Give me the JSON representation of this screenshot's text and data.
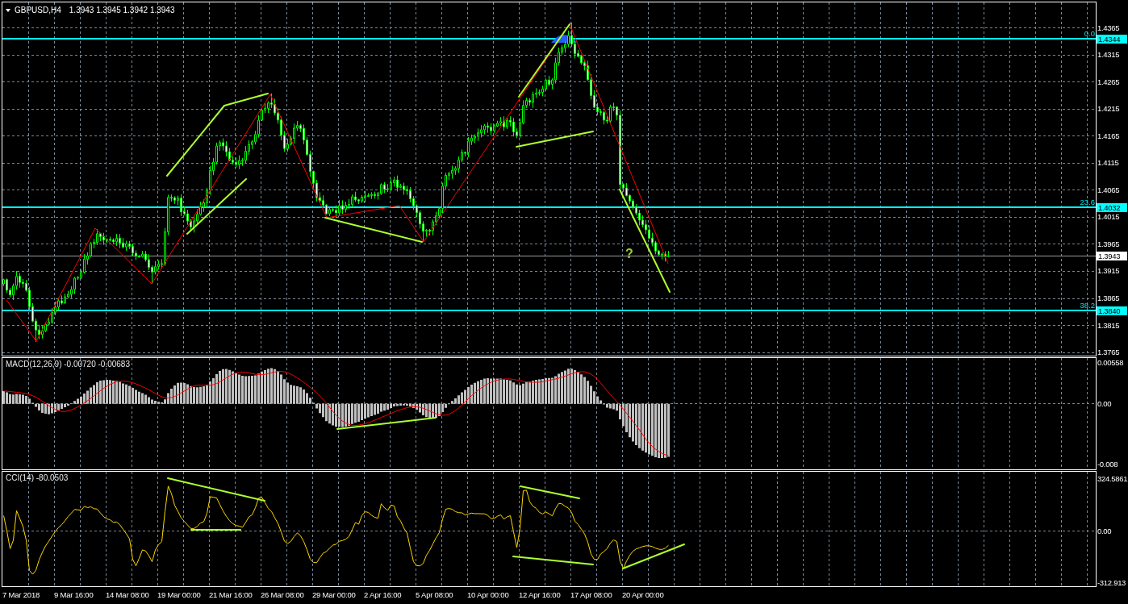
{
  "chart": {
    "symbol": "GBPUSD,H4",
    "quote": "1.3943 1.3945 1.3942 1.3943"
  },
  "price_panel": {
    "axis_labels": [
      "1.4365",
      "1.4315",
      "1.4265",
      "1.4215",
      "1.4165",
      "1.4115",
      "1.4065",
      "1.4015",
      "1.3965",
      "1.3915",
      "1.3865",
      "1.3815",
      "1.3765"
    ],
    "fibonacci_levels": [
      {
        "ratio": "0.0",
        "price": "1.4344"
      },
      {
        "ratio": "23.6",
        "price": "1.4032"
      },
      {
        "ratio": "38.2",
        "price": "1.3840"
      }
    ],
    "current_price": "1.3943",
    "annotation": "?"
  },
  "indicators": [
    {
      "kind": "macd",
      "title": "MACD(12,26,9) -0.00720 -0.00683",
      "axis_labels": [
        "0.00558",
        "0.00",
        "-0.008"
      ]
    },
    {
      "kind": "cci",
      "title": "CCI(14) -80.0503",
      "axis_labels": [
        "324.5861",
        "0.00",
        "-312.913"
      ]
    }
  ],
  "time_axis": {
    "labels": [
      "7 Mar 2018",
      "9 Mar 16:00",
      "14 Mar 08:00",
      "19 Mar 00:00",
      "21 Mar 16:00",
      "26 Mar 08:00",
      "29 Mar 00:00",
      "2 Apr 16:00",
      "5 Apr 08:00",
      "10 Apr 00:00",
      "12 Apr 16:00",
      "17 Apr 08:00",
      "20 Apr 00:00"
    ]
  }
}
